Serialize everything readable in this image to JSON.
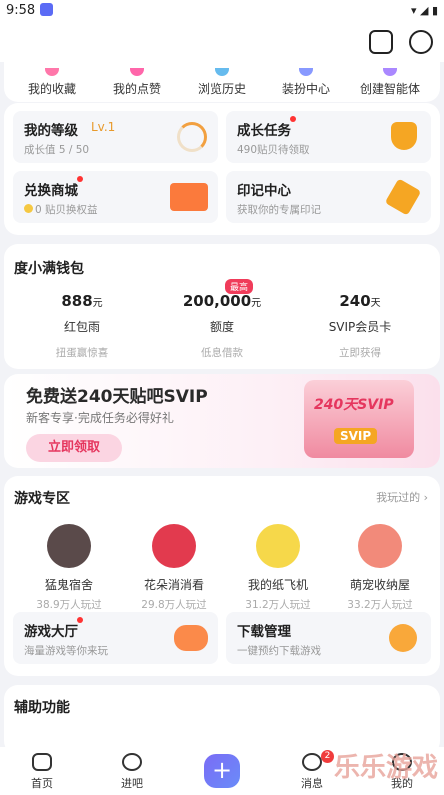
{
  "status_bar": {
    "time": "9:58"
  },
  "quick_links": [
    "我的收藏",
    "我的点赞",
    "浏览历史",
    "装扮中心",
    "创建智能体"
  ],
  "tiles": {
    "level": {
      "title": "我的等级",
      "level": "Lv.1",
      "sub": "成长值 5 / 50"
    },
    "growth": {
      "title": "成长任务",
      "sub": "490贴贝待领取"
    },
    "mall": {
      "title": "兑换商城",
      "sub": "0 贴贝换权益"
    },
    "mark": {
      "title": "印记中心",
      "sub": "获取你的专属印记"
    }
  },
  "wallet": {
    "title": "度小满钱包",
    "badge": "最高",
    "items": [
      {
        "value": "888",
        "unit": "元",
        "name": "红包雨",
        "desc": "扭蛋赢惊喜"
      },
      {
        "value": "200,000",
        "unit": "元",
        "name": "额度",
        "desc": "低息借款"
      },
      {
        "value": "240",
        "unit": "天",
        "name": "SVIP会员卡",
        "desc": "立即获得"
      }
    ]
  },
  "banner": {
    "title": "免费送240天贴吧SVIP",
    "sub": "新客专享·完成任务必得好礼",
    "button": "立即领取",
    "card_text": "240天SVIP",
    "card_logo": "SVIP"
  },
  "games": {
    "title": "游戏专区",
    "link": "我玩过的",
    "items": [
      {
        "name": "猛鬼宿舍",
        "players": "38.9万人玩过"
      },
      {
        "name": "花朵消消看",
        "players": "29.8万人玩过"
      },
      {
        "name": "我的纸飞机",
        "players": "31.2万人玩过"
      },
      {
        "name": "萌宠收纳屋",
        "players": "33.2万人玩过"
      }
    ],
    "hall": {
      "title": "游戏大厅",
      "sub": "海量游戏等你来玩"
    },
    "download": {
      "title": "下载管理",
      "sub": "一键预约下载游戏"
    }
  },
  "assist": {
    "title": "辅助功能"
  },
  "nav": {
    "items": [
      "首页",
      "进吧",
      "消息",
      "我的"
    ],
    "badge": "2"
  },
  "watermark": "乐乐游戏",
  "colors": {
    "accent": "#5b6bf5",
    "red": "#f03c5a",
    "orange": "#f5a623"
  }
}
